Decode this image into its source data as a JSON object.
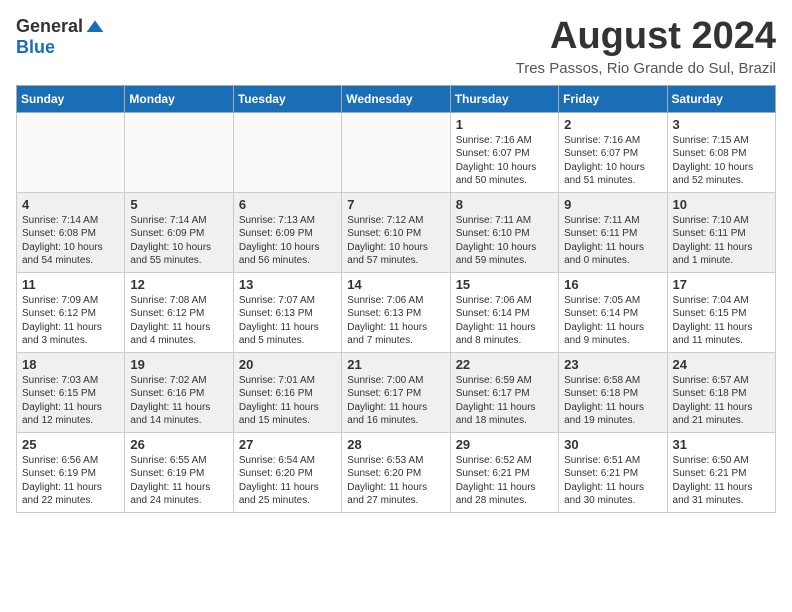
{
  "header": {
    "logo_general": "General",
    "logo_blue": "Blue",
    "month_title": "August 2024",
    "location": "Tres Passos, Rio Grande do Sul, Brazil"
  },
  "calendar": {
    "days_of_week": [
      "Sunday",
      "Monday",
      "Tuesday",
      "Wednesday",
      "Thursday",
      "Friday",
      "Saturday"
    ],
    "weeks": [
      [
        {
          "day": "",
          "info": ""
        },
        {
          "day": "",
          "info": ""
        },
        {
          "day": "",
          "info": ""
        },
        {
          "day": "",
          "info": ""
        },
        {
          "day": "1",
          "info": "Sunrise: 7:16 AM\nSunset: 6:07 PM\nDaylight: 10 hours and 50 minutes."
        },
        {
          "day": "2",
          "info": "Sunrise: 7:16 AM\nSunset: 6:07 PM\nDaylight: 10 hours and 51 minutes."
        },
        {
          "day": "3",
          "info": "Sunrise: 7:15 AM\nSunset: 6:08 PM\nDaylight: 10 hours and 52 minutes."
        }
      ],
      [
        {
          "day": "4",
          "info": "Sunrise: 7:14 AM\nSunset: 6:08 PM\nDaylight: 10 hours and 54 minutes."
        },
        {
          "day": "5",
          "info": "Sunrise: 7:14 AM\nSunset: 6:09 PM\nDaylight: 10 hours and 55 minutes."
        },
        {
          "day": "6",
          "info": "Sunrise: 7:13 AM\nSunset: 6:09 PM\nDaylight: 10 hours and 56 minutes."
        },
        {
          "day": "7",
          "info": "Sunrise: 7:12 AM\nSunset: 6:10 PM\nDaylight: 10 hours and 57 minutes."
        },
        {
          "day": "8",
          "info": "Sunrise: 7:11 AM\nSunset: 6:10 PM\nDaylight: 10 hours and 59 minutes."
        },
        {
          "day": "9",
          "info": "Sunrise: 7:11 AM\nSunset: 6:11 PM\nDaylight: 11 hours and 0 minutes."
        },
        {
          "day": "10",
          "info": "Sunrise: 7:10 AM\nSunset: 6:11 PM\nDaylight: 11 hours and 1 minute."
        }
      ],
      [
        {
          "day": "11",
          "info": "Sunrise: 7:09 AM\nSunset: 6:12 PM\nDaylight: 11 hours and 3 minutes."
        },
        {
          "day": "12",
          "info": "Sunrise: 7:08 AM\nSunset: 6:12 PM\nDaylight: 11 hours and 4 minutes."
        },
        {
          "day": "13",
          "info": "Sunrise: 7:07 AM\nSunset: 6:13 PM\nDaylight: 11 hours and 5 minutes."
        },
        {
          "day": "14",
          "info": "Sunrise: 7:06 AM\nSunset: 6:13 PM\nDaylight: 11 hours and 7 minutes."
        },
        {
          "day": "15",
          "info": "Sunrise: 7:06 AM\nSunset: 6:14 PM\nDaylight: 11 hours and 8 minutes."
        },
        {
          "day": "16",
          "info": "Sunrise: 7:05 AM\nSunset: 6:14 PM\nDaylight: 11 hours and 9 minutes."
        },
        {
          "day": "17",
          "info": "Sunrise: 7:04 AM\nSunset: 6:15 PM\nDaylight: 11 hours and 11 minutes."
        }
      ],
      [
        {
          "day": "18",
          "info": "Sunrise: 7:03 AM\nSunset: 6:15 PM\nDaylight: 11 hours and 12 minutes."
        },
        {
          "day": "19",
          "info": "Sunrise: 7:02 AM\nSunset: 6:16 PM\nDaylight: 11 hours and 14 minutes."
        },
        {
          "day": "20",
          "info": "Sunrise: 7:01 AM\nSunset: 6:16 PM\nDaylight: 11 hours and 15 minutes."
        },
        {
          "day": "21",
          "info": "Sunrise: 7:00 AM\nSunset: 6:17 PM\nDaylight: 11 hours and 16 minutes."
        },
        {
          "day": "22",
          "info": "Sunrise: 6:59 AM\nSunset: 6:17 PM\nDaylight: 11 hours and 18 minutes."
        },
        {
          "day": "23",
          "info": "Sunrise: 6:58 AM\nSunset: 6:18 PM\nDaylight: 11 hours and 19 minutes."
        },
        {
          "day": "24",
          "info": "Sunrise: 6:57 AM\nSunset: 6:18 PM\nDaylight: 11 hours and 21 minutes."
        }
      ],
      [
        {
          "day": "25",
          "info": "Sunrise: 6:56 AM\nSunset: 6:19 PM\nDaylight: 11 hours and 22 minutes."
        },
        {
          "day": "26",
          "info": "Sunrise: 6:55 AM\nSunset: 6:19 PM\nDaylight: 11 hours and 24 minutes."
        },
        {
          "day": "27",
          "info": "Sunrise: 6:54 AM\nSunset: 6:20 PM\nDaylight: 11 hours and 25 minutes."
        },
        {
          "day": "28",
          "info": "Sunrise: 6:53 AM\nSunset: 6:20 PM\nDaylight: 11 hours and 27 minutes."
        },
        {
          "day": "29",
          "info": "Sunrise: 6:52 AM\nSunset: 6:21 PM\nDaylight: 11 hours and 28 minutes."
        },
        {
          "day": "30",
          "info": "Sunrise: 6:51 AM\nSunset: 6:21 PM\nDaylight: 11 hours and 30 minutes."
        },
        {
          "day": "31",
          "info": "Sunrise: 6:50 AM\nSunset: 6:21 PM\nDaylight: 11 hours and 31 minutes."
        }
      ]
    ]
  }
}
